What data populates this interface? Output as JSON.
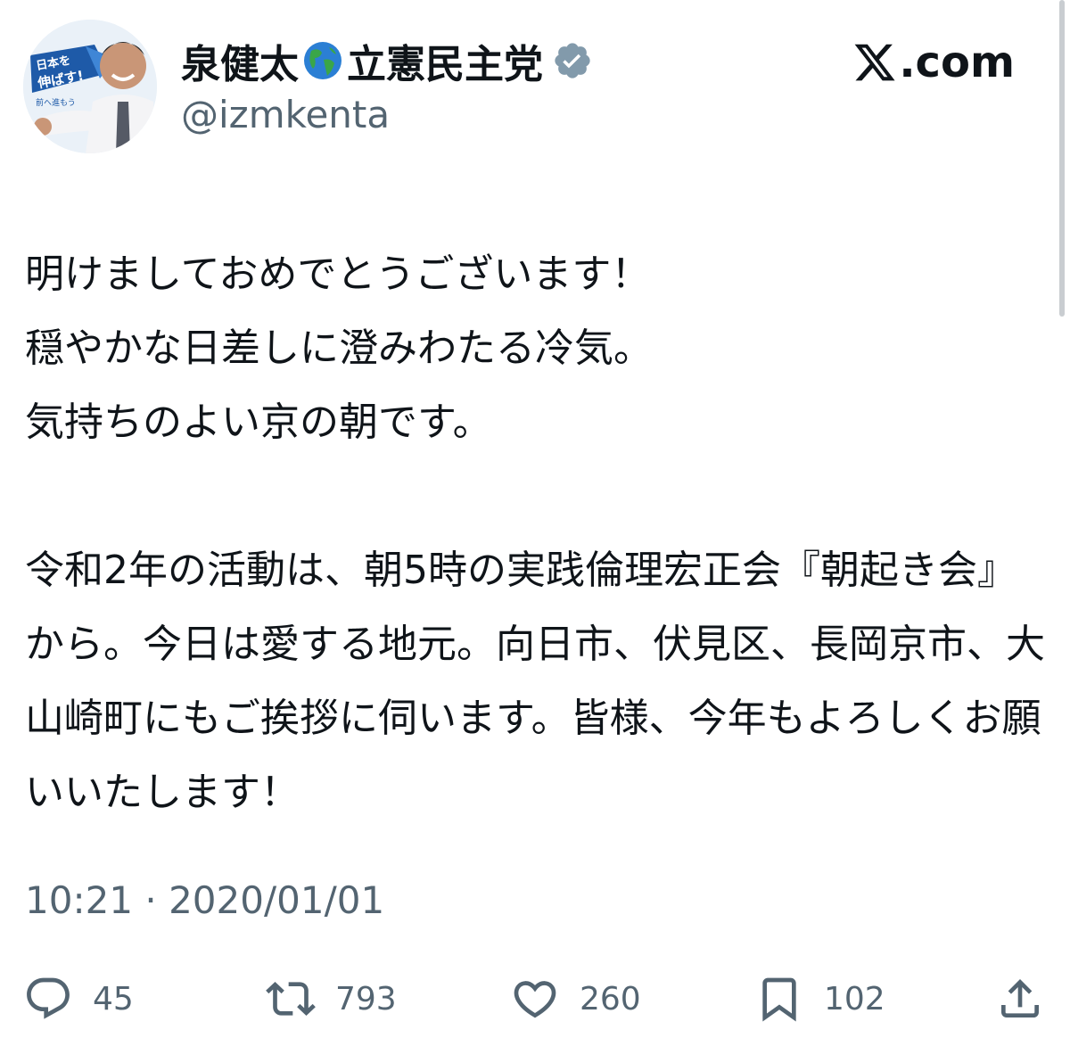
{
  "post": {
    "author": {
      "display_name": "泉健太",
      "party": "立憲民主党",
      "handle": "@izmkenta",
      "avatar_slogan_top": "日本を",
      "avatar_slogan_bottom": "伸ばす!",
      "avatar_slogan_sub": "前へ進もう"
    },
    "brand": ".com",
    "text": "明けましておめでとうございます！\n穏やかな日差しに澄みわたる冷気。\n気持ちのよい京の朝です。\n\n令和2年の活動は、朝5時の実践倫理宏正会『朝起き会』から。今日は愛する地元。向日市、伏見区、長岡京市、大山崎町にもご挨拶に伺います。皆様、今年もよろしくお願いいたします！",
    "timestamp": "10:21 · 2020/01/01",
    "stats": {
      "replies": "45",
      "reposts": "793",
      "likes": "260",
      "bookmarks": "102"
    }
  },
  "icons": [
    "globe-icon",
    "verified-badge-icon",
    "x-logo-icon",
    "reply-icon",
    "repost-icon",
    "like-icon",
    "bookmark-icon",
    "share-icon"
  ],
  "colors": {
    "text_primary": "#0f1419",
    "text_secondary": "#536471",
    "verified_badge": "#829aab",
    "background": "#ffffff"
  }
}
